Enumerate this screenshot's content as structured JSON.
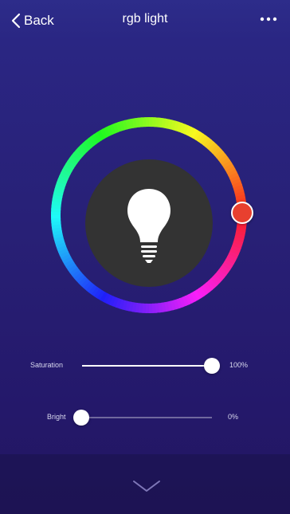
{
  "navbar": {
    "back_label": "Back",
    "title": "rgb light",
    "more_icon": "more-horizontal-icon"
  },
  "color_wheel": {
    "selected_color": "#e8402f",
    "center_icon": "light-bulb-icon",
    "center_fill": "#333333"
  },
  "saturation": {
    "label": "Saturation",
    "value_label": "100%",
    "value": 1.0
  },
  "brightness": {
    "label": "Bright",
    "value_label": "0%",
    "value": 0.0
  },
  "bottom": {
    "collapse_icon": "chevron-down-icon"
  }
}
